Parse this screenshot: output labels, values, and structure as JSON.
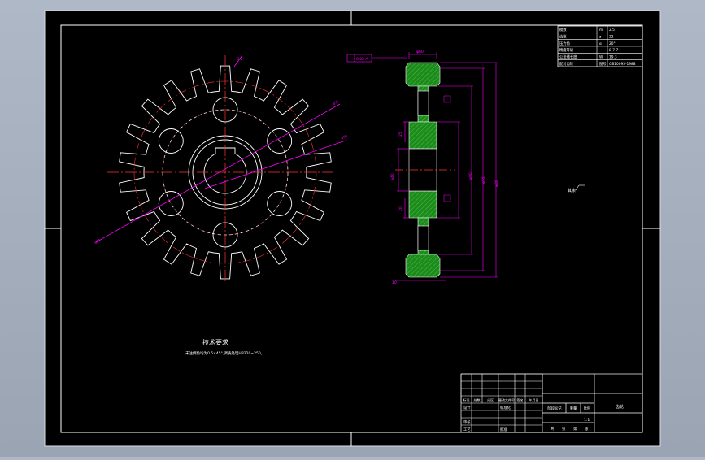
{
  "drawing": {
    "title_block": {
      "part_name": "齿轮",
      "labels_row1": [
        "标记",
        "处数",
        "分区",
        "更改文件号",
        "签名",
        "年月日"
      ],
      "labels_row2": [
        "设计",
        "标准化"
      ],
      "labels_row3": [
        "审核",
        "工艺",
        "批准"
      ],
      "stage_labels": [
        "阶段标记",
        "重量",
        "比例"
      ],
      "scale": "1:1",
      "sheet_labels": [
        "共",
        "张",
        "第",
        "张"
      ]
    },
    "parameter_table": {
      "rows": [
        [
          "模数",
          "m",
          "2.5"
        ],
        [
          "齿数",
          "z",
          "22"
        ],
        [
          "压力角",
          "α",
          "20°"
        ],
        [
          "精度等级",
          "",
          "8-7-7"
        ],
        [
          "公法线长度",
          "W",
          "19.3"
        ],
        [
          "配对齿轮",
          "图号",
          "GB10095-1988"
        ]
      ]
    },
    "technical_requirements": {
      "title": "技术要求",
      "text": "未注倒角均为0.5×45°,调质处理HB220~250。"
    },
    "annotations": {
      "surface_roughness_note": "其余",
      "datum_box": "0.02 A",
      "view_dims": [
        "φ60",
        "φ55",
        "φ80",
        "φ90",
        "φ40",
        "25",
        "20",
        "10"
      ]
    }
  },
  "colors": {
    "screen_bg": "#9aa4b3",
    "paper": "#000000",
    "frame": "#ffffff",
    "dimension": "#ff00ff",
    "centerline": "#ff3333",
    "hatch": "#1e8a1e",
    "fill": "#c0c0c0"
  }
}
